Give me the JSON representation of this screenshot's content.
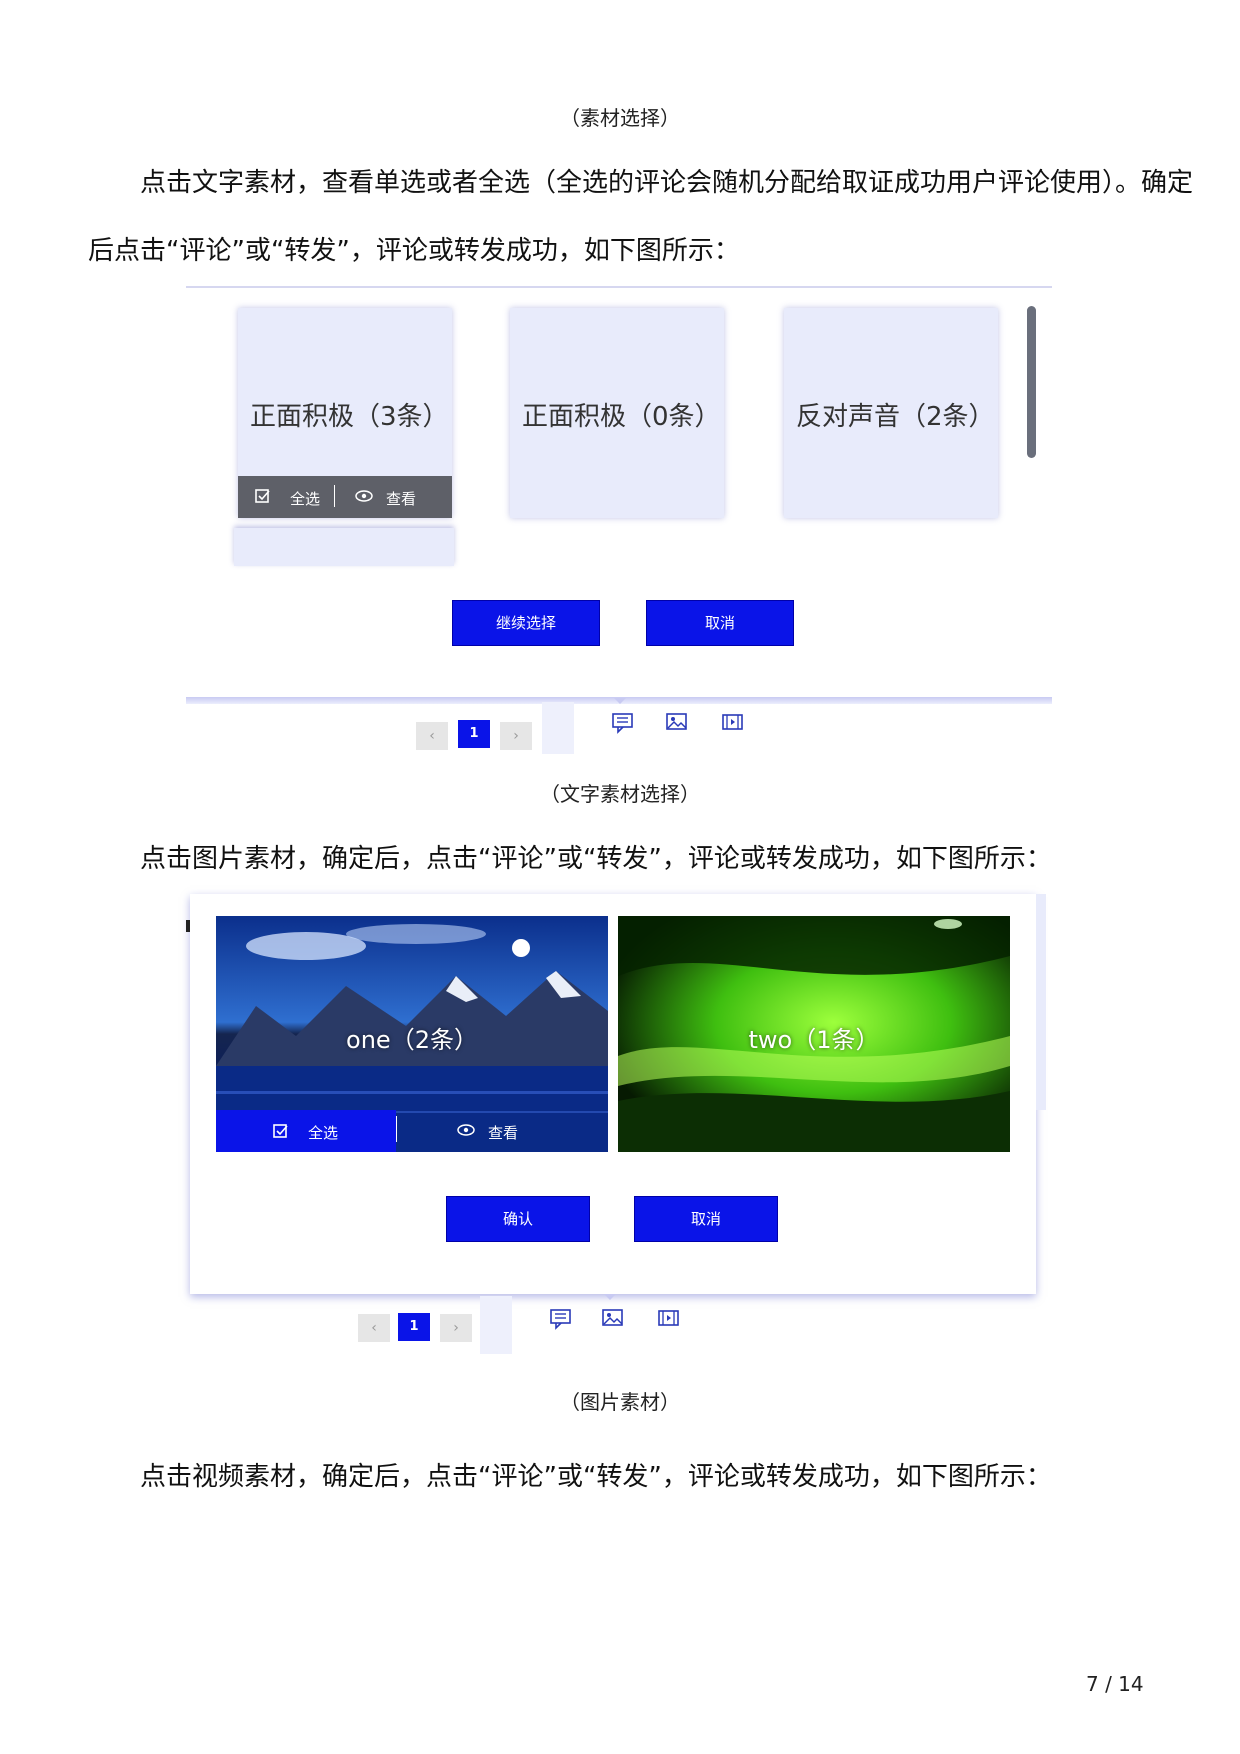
{
  "captions": {
    "material_select": "（素材选择）",
    "text_material_select": "（文字素材选择）",
    "image_material": "（图片素材）"
  },
  "paragraphs": {
    "p1_line1": "点击文字素材，查看单选或者全选（全选的评论会随机分配给取证成功用户评论使用）。确定",
    "p1_line2": "后点击“评论”或“转发”，评论或转发成功，如下图所示：",
    "p2": "点击图片素材，确定后，点击“评论”或“转发”，评论或转发成功，如下图所示：",
    "p3": "点击视频素材，确定后，点击“评论”或“转发”，评论或转发成功，如下图所示："
  },
  "text_figure": {
    "cards": [
      {
        "title": "正面积极（3条）"
      },
      {
        "title": "正面积极（0条）"
      },
      {
        "title": "反对声音（2条）"
      }
    ],
    "card_actions": {
      "select_all": "全选",
      "view": "查看"
    },
    "buttons": {
      "continue": "继续选择",
      "cancel": "取消"
    },
    "pager": {
      "current_page": "1",
      "prev": "‹",
      "next": "›"
    },
    "toolbar_icons": [
      "comment-icon",
      "image-icon",
      "video-icon"
    ]
  },
  "image_figure": {
    "tiles": [
      {
        "label": "one（2条）"
      },
      {
        "label": "two（1条）"
      }
    ],
    "tile_actions": {
      "select_all": "全选",
      "view": "查看"
    },
    "buttons": {
      "confirm": "确认",
      "cancel": "取消"
    },
    "pager": {
      "current_page": "1",
      "prev": "‹",
      "next": "›"
    },
    "toolbar_icons": [
      "comment-icon",
      "image-icon",
      "video-icon"
    ]
  },
  "page_number": "7 / 14",
  "colors": {
    "accent_blue": "#0a14e8",
    "card_bg": "#e8ebfb",
    "action_bar": "#5e6068"
  }
}
